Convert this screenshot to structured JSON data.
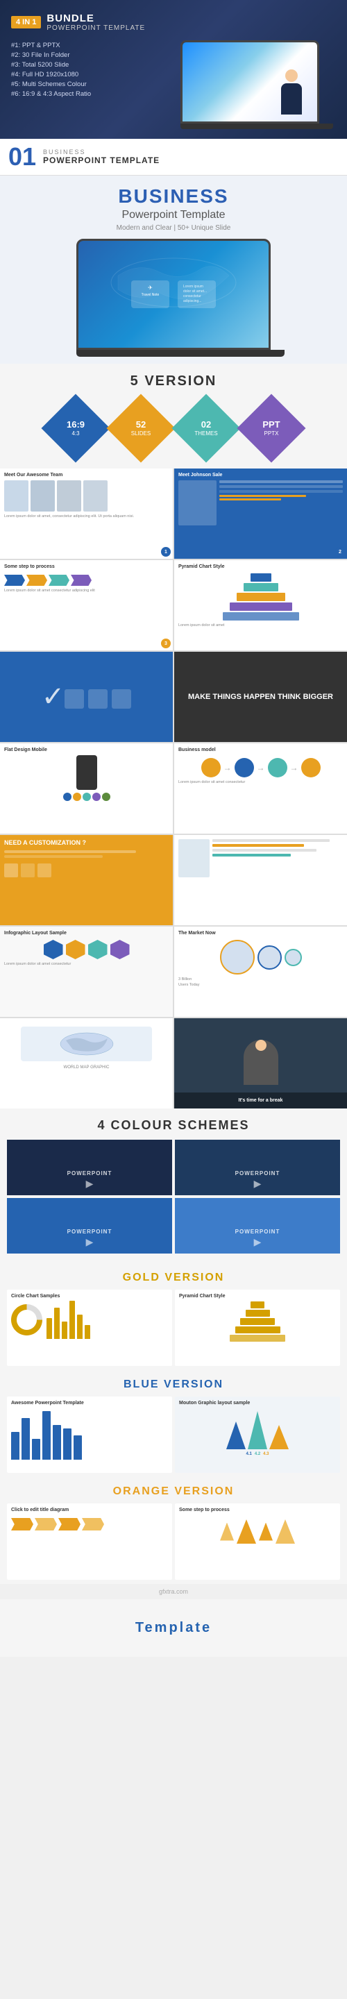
{
  "header": {
    "badge": "4 IN 1",
    "type": "BUNDLE",
    "title": "POWERPOINT TEMPLATE",
    "features": [
      "#1: PPT & PPTX",
      "#2: 30 File In Folder",
      "#3: Total 5200 Slide",
      "#4: Full HD 1920x1080",
      "#5: Multi Schemes Colour",
      "#6: 16:9 & 4:3 Aspect Ratio"
    ]
  },
  "section01": {
    "number": "01",
    "top_label": "BUSINESS",
    "main_label": "POWERPOINT TEMPLATE",
    "big_title": "BUSINESS",
    "sub_title": "Powerpoint Template",
    "tagline": "Modern and Clear | 50+ Unique Slide"
  },
  "versions_section": {
    "title": "5 VERSION",
    "diamonds": [
      {
        "main": "16:9",
        "sub": "4:3",
        "color": "blue"
      },
      {
        "main": "52",
        "sub": "SLIDES",
        "color": "orange"
      },
      {
        "main": "02",
        "sub": "THEMES",
        "color": "teal"
      },
      {
        "main": "PPT",
        "sub": "PPTX",
        "color": "purple"
      }
    ]
  },
  "slide_previews": [
    {
      "title": "Meet Our Awesome Team",
      "type": "team"
    },
    {
      "title": "Meet Johnson Sale",
      "type": "johnson"
    },
    {
      "title": "Some step to process",
      "type": "steps"
    },
    {
      "title": "Pyramid Chart Style",
      "type": "pyramid"
    },
    {
      "title": "",
      "type": "checkmark"
    },
    {
      "title": "MAKE THINGS HAPPEN\nTHINK BIGGER",
      "type": "makethings"
    },
    {
      "title": "Flat Design Mobile",
      "type": "mobile"
    },
    {
      "title": "Business model",
      "type": "business_model"
    },
    {
      "title": "NEED A CUSTOMIZATION ?",
      "type": "need_custom"
    },
    {
      "title": "",
      "type": "need_custom_content"
    },
    {
      "title": "Infographic Layout Sample",
      "type": "infographic"
    },
    {
      "title": "The Market Now",
      "type": "market"
    },
    {
      "title": "WORLD MAP GRAPHIC",
      "type": "worldmap"
    },
    {
      "title": "It's time for a break",
      "type": "break"
    }
  ],
  "schemes_section": {
    "title": "4 COLOUR SCHEMES",
    "schemes": [
      {
        "label": "POWERPOINT",
        "arrow": "▶",
        "shade": "dark1"
      },
      {
        "label": "POWERPOINT",
        "arrow": "▶",
        "shade": "dark2"
      },
      {
        "label": "POWERPOINT",
        "arrow": "▶",
        "shade": "light1"
      },
      {
        "label": "POWERPOINT",
        "arrow": "▶",
        "shade": "light2"
      }
    ]
  },
  "gold_version": {
    "label": "GOLD VERSION",
    "previews": [
      {
        "title": "Circle Chart Samples",
        "type": "gold_donut"
      },
      {
        "title": "Pyramid Chart Style",
        "type": "gold_pyramid"
      }
    ]
  },
  "blue_version": {
    "label": "BLUE VERSION",
    "previews": [
      {
        "title": "Awesome Powerpoint Template",
        "type": "blue_bars"
      },
      {
        "title": "Mouton Graphic layout sample",
        "type": "mouton"
      }
    ]
  },
  "orange_version": {
    "label": "ORANGE VERSION",
    "previews": [
      {
        "title": "Click to edit title diagram",
        "type": "orange_arrows"
      },
      {
        "title": "Some step to process",
        "type": "orange_wings"
      }
    ]
  },
  "footer": {
    "watermark": "gfxtra.com"
  },
  "template_section": {
    "label": "Template"
  }
}
